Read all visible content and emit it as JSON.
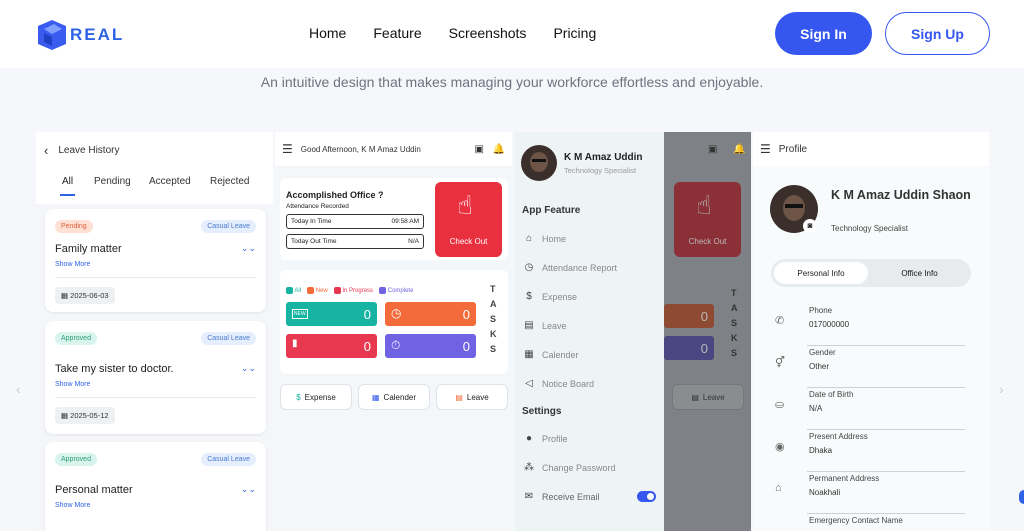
{
  "nav": {
    "logo_text": "REAL",
    "links": [
      "Home",
      "Feature",
      "Screenshots",
      "Pricing"
    ],
    "signin": "Sign In",
    "signup": "Sign Up"
  },
  "tagline": "An intuitive design that makes managing your workforce effortless and enjoyable.",
  "leave": {
    "title": "Leave History",
    "tabs": [
      "All",
      "Pending",
      "Accepted",
      "Rejected"
    ],
    "cards": [
      {
        "status": "Pending",
        "type": "Casual Leave",
        "title": "Family matter",
        "more": "Show More",
        "date": "2025-06-03"
      },
      {
        "status": "Approved",
        "type": "Casual Leave",
        "title": "Take my sister to doctor.",
        "more": "Show More",
        "date": "2025-05-12"
      },
      {
        "status": "Approved",
        "type": "Casual Leave",
        "title": "Personal matter",
        "more": "Show More"
      }
    ]
  },
  "dash": {
    "greeting": "Good Afternoon, K M Amaz Uddin",
    "acc_title": "Accomplished Office ?",
    "att": "Attendance Recorded",
    "in_label": "Today In Time",
    "in_time": "09:58 AM",
    "out_label": "Today Out Time",
    "out_time": "N/A",
    "checkout": "Check Out",
    "legend": [
      "All",
      "New",
      "In Progress",
      "Complete"
    ],
    "tiles": [
      "0",
      "0",
      "0",
      "0"
    ],
    "tasks": "TASKS",
    "new_badge": "NEW",
    "actions": [
      "Expense",
      "Calender",
      "Leave"
    ]
  },
  "drawer": {
    "name": "K M Amaz Uddin",
    "role": "Technology Specialist",
    "section1": "App Feature",
    "items": [
      "Home",
      "Attendance Report",
      "Expense",
      "Leave",
      "Calender",
      "Notice Board"
    ],
    "section2": "Settings",
    "items2": [
      "Profile",
      "Change Password",
      "Receive Email"
    ],
    "receive_email_on": true,
    "bg_checkout": "Check Out",
    "bg_leave": "Leave",
    "bg_tasks": "TASKS",
    "bg_tiles": [
      "0",
      "0"
    ]
  },
  "profile": {
    "title": "Profile",
    "name": "K M Amaz Uddin Shaon",
    "role": "Technology Specialist",
    "tab1": "Personal Info",
    "tab2": "Office Info",
    "fields": [
      {
        "label": "Phone",
        "value": "017000000",
        "icon": "phone-icon"
      },
      {
        "label": "Gender",
        "value": "Other",
        "icon": "gender-icon"
      },
      {
        "label": "Date of Birth",
        "value": "N/A",
        "icon": "cake-icon"
      },
      {
        "label": "Present Address",
        "value": "Dhaka",
        "icon": "location-icon"
      },
      {
        "label": "Permanent Address",
        "value": "Noakhali",
        "icon": "home-icon"
      },
      {
        "label": "Emergency Contact Name",
        "value": "",
        "icon": "contact-icon"
      }
    ]
  },
  "colors": {
    "accent": "#3557f0",
    "checkout": "#e8303f",
    "teal": "#17b3a3",
    "orange": "#f36b3a",
    "red": "#e8384f",
    "purple": "#6f63e4"
  }
}
